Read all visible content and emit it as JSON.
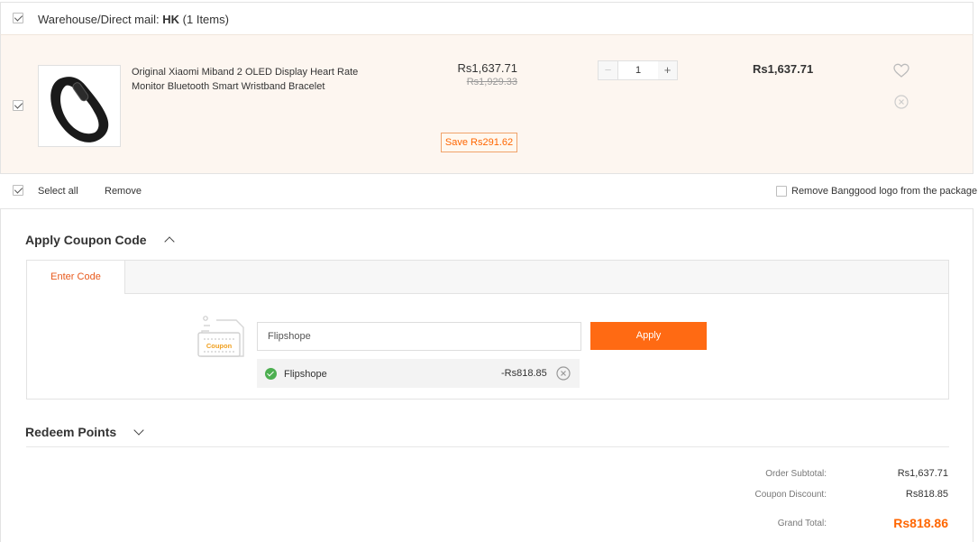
{
  "warehouse": {
    "label": "Warehouse/Direct mail:",
    "code": "HK",
    "count": "(1 Items)"
  },
  "product": {
    "name": "Original Xiaomi Miband 2 OLED Display Heart Rate Monitor Bluetooth Smart Wristband Bracelet",
    "price": "Rs1,637.71",
    "old_price": "Rs1,929.33",
    "save": "Save Rs291.62",
    "qty_minus": "−",
    "qty_plus": "+",
    "quantity": "1",
    "line_total": "Rs1,637.71",
    "wishlist_icon": "heart-icon",
    "remove_icon": "close-circle-icon"
  },
  "actions": {
    "select_all": "Select all",
    "remove": "Remove",
    "remove_logo": "Remove Banggood logo from the package"
  },
  "coupon": {
    "title": "Apply Coupon Code",
    "tab": "Enter Code",
    "input_value": "Flipshope",
    "apply": "Apply",
    "image_text": "Coupon",
    "applied_name": "Flipshope",
    "applied_discount": "-Rs818.85"
  },
  "redeem": {
    "title": "Redeem Points"
  },
  "summary": {
    "subtotal_label": "Order Subtotal:",
    "subtotal_value": "Rs1,637.71",
    "discount_label": "Coupon Discount:",
    "discount_value": "Rs818.85",
    "grand_label": "Grand Total:",
    "grand_value": "Rs818.86"
  },
  "colors": {
    "accent": "#ff6a13",
    "row_bg": "#fdf6f0",
    "success": "#4caf50"
  }
}
